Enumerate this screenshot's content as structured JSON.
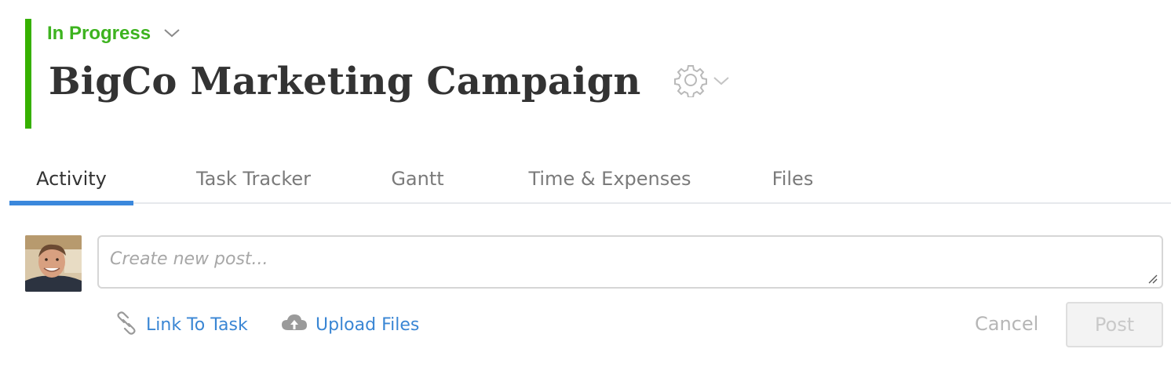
{
  "project": {
    "status": "In Progress",
    "title": "BigCo Marketing Campaign",
    "status_color": "#3db31f",
    "accent_bar_color": "#36b000"
  },
  "tabs": [
    {
      "label": "Activity",
      "active": true
    },
    {
      "label": "Task Tracker",
      "active": false
    },
    {
      "label": "Gantt",
      "active": false
    },
    {
      "label": "Time & Expenses",
      "active": false
    },
    {
      "label": "Files",
      "active": false
    }
  ],
  "composer": {
    "placeholder": "Create new post...",
    "link_to_task": "Link To Task",
    "upload_files": "Upload Files",
    "cancel": "Cancel",
    "post": "Post"
  },
  "icons": {
    "status_dropdown": "chevron-down-icon",
    "settings": "gear-icon",
    "settings_dropdown": "chevron-down-icon",
    "link": "paperclip-icon",
    "upload": "cloud-upload-icon"
  },
  "colors": {
    "tab_active_underline": "#3b88dc",
    "link": "#3a86d4"
  }
}
